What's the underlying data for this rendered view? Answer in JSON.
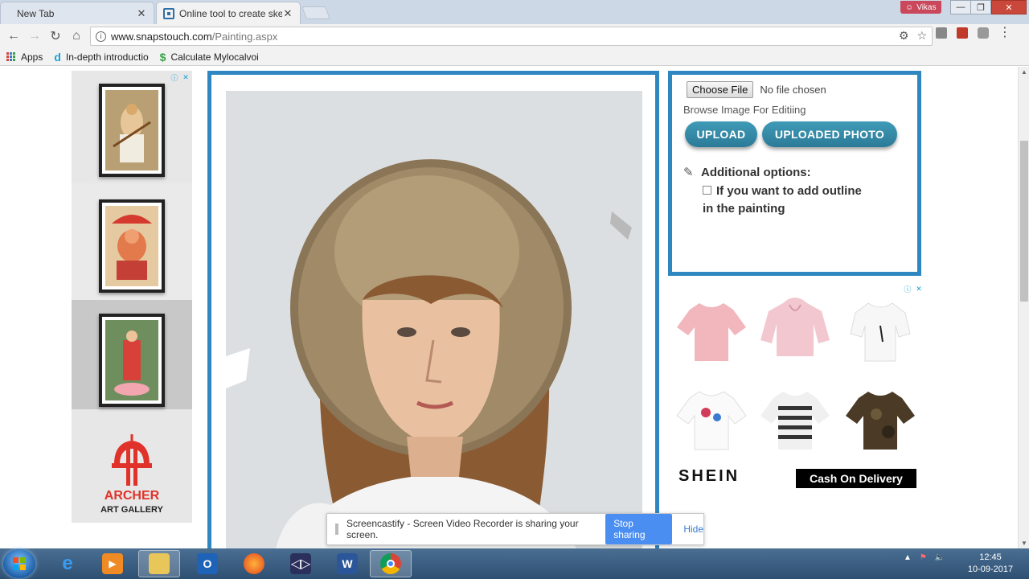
{
  "browser": {
    "tabs": [
      {
        "title": "New Tab",
        "active": false
      },
      {
        "title": "Online tool to create ske",
        "active": true
      }
    ],
    "profile_name": "Vikas",
    "url_host": "www.snapstouch.com",
    "url_path": "/Painting.aspx",
    "bookmarks": [
      {
        "label": "Apps",
        "icon": "apps-grid-icon"
      },
      {
        "label": "In-depth introductio",
        "icon": "d-logo-icon"
      },
      {
        "label": "Calculate Mylocalvoi",
        "icon": "dollar-icon"
      }
    ]
  },
  "left_ad": {
    "brand": "ARCHER",
    "subtitle": "ART GALLERY"
  },
  "controls": {
    "choose_file_label": "Choose File",
    "no_file_text": "No file chosen",
    "browse_label": "Browse Image For Editiing",
    "upload_label": "UPLOAD",
    "uploaded_label": "UPLOADED PHOTO",
    "additional_options": "Additional options:",
    "outline_option": "If you want to add outline in the painting",
    "outline_checked": false
  },
  "right_ad": {
    "brand": "SHEIN",
    "cta": "Cash On Delivery"
  },
  "share_notice": {
    "message": "Screencastify - Screen Video Recorder is sharing your screen.",
    "stop_label": "Stop sharing",
    "hide_label": "Hide"
  },
  "taskbar": {
    "apps": [
      "internet-explorer",
      "media-player",
      "file-explorer",
      "outlook",
      "firefox",
      "visual-studio",
      "word",
      "chrome"
    ],
    "time": "12:45",
    "date": "10-09-2017"
  },
  "colors": {
    "panel_border": "#2e87c0",
    "button_teal": "#2b7b98",
    "archer_red": "#e0322a"
  }
}
